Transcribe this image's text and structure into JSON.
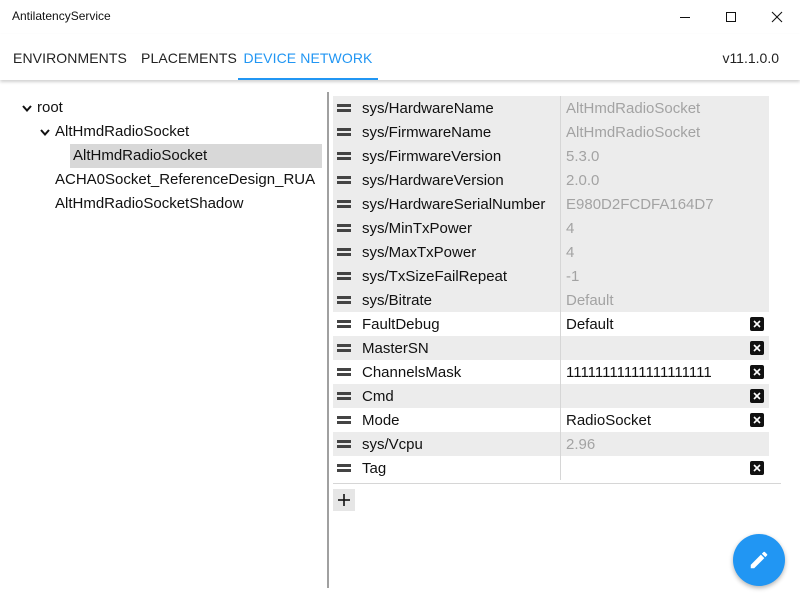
{
  "window": {
    "title": "AntilatencyService",
    "controls": {
      "minimize": "minimize-icon",
      "maximize": "maximize-icon",
      "close": "close-icon"
    }
  },
  "tabs": [
    {
      "label": "ENVIRONMENTS",
      "active": false
    },
    {
      "label": "PLACEMENTS",
      "active": false
    },
    {
      "label": "DEVICE NETWORK",
      "active": true
    }
  ],
  "version": "v11.1.0.0",
  "colors": {
    "accent": "#2196f3",
    "selected": "#d8d8d8",
    "row_alt": "#ececec",
    "readonly_text": "#a3a3a3"
  },
  "tree": {
    "root": "root",
    "child": "AltHmdRadioSocket",
    "selected": "AltHmdRadioSocket",
    "sibling1": "ACHA0Socket_ReferenceDesign_RUA",
    "sibling2": "AltHmdRadioSocketShadow"
  },
  "properties": [
    {
      "key": "sys/HardwareName",
      "value": "AltHmdRadioSocket",
      "readonly": true,
      "deletable": false
    },
    {
      "key": "sys/FirmwareName",
      "value": "AltHmdRadioSocket",
      "readonly": true,
      "deletable": false
    },
    {
      "key": "sys/FirmwareVersion",
      "value": "5.3.0",
      "readonly": true,
      "deletable": false
    },
    {
      "key": "sys/HardwareVersion",
      "value": "2.0.0",
      "readonly": true,
      "deletable": false
    },
    {
      "key": "sys/HardwareSerialNumber",
      "value": "E980D2FCDFA164D7",
      "readonly": true,
      "deletable": false
    },
    {
      "key": "sys/MinTxPower",
      "value": "4",
      "readonly": true,
      "deletable": false
    },
    {
      "key": "sys/MaxTxPower",
      "value": "4",
      "readonly": true,
      "deletable": false
    },
    {
      "key": "sys/TxSizeFailRepeat",
      "value": "-1",
      "readonly": true,
      "deletable": false
    },
    {
      "key": "sys/Bitrate",
      "value": "Default",
      "readonly": true,
      "deletable": false
    },
    {
      "key": "FaultDebug",
      "value": "Default",
      "readonly": false,
      "deletable": true
    },
    {
      "key": "MasterSN",
      "value": "",
      "readonly": false,
      "deletable": true
    },
    {
      "key": "ChannelsMask",
      "value": "11111111111111111111",
      "readonly": false,
      "deletable": true
    },
    {
      "key": "Cmd",
      "value": "",
      "readonly": false,
      "deletable": true
    },
    {
      "key": "Mode",
      "value": "RadioSocket",
      "readonly": false,
      "deletable": true
    },
    {
      "key": "sys/Vcpu",
      "value": "2.96",
      "readonly": true,
      "deletable": false
    },
    {
      "key": "Tag",
      "value": "",
      "readonly": false,
      "deletable": true
    }
  ],
  "icons": {
    "add": "plus-icon",
    "edit": "pencil-icon",
    "drag": "drag-handle-icon",
    "delete": "delete-icon"
  }
}
